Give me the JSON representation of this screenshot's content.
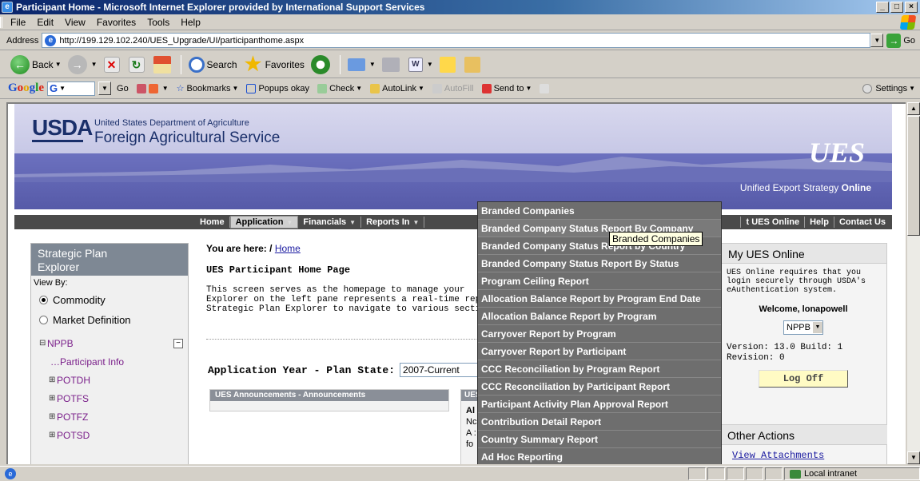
{
  "window": {
    "title": "Participant Home - Microsoft Internet Explorer provided by International Support Services",
    "menu": [
      "File",
      "Edit",
      "View",
      "Favorites",
      "Tools",
      "Help"
    ],
    "address_label": "Address",
    "address_url": "http://199.129.102.240/UES_Upgrade/UI/participanthome.aspx",
    "go_label": "Go"
  },
  "toolbar": {
    "back": "Back",
    "search": "Search",
    "favorites": "Favorites"
  },
  "googlebar": {
    "go": "Go",
    "bookmarks": "Bookmarks",
    "popups": "Popups okay",
    "check": "Check",
    "autolink": "AutoLink",
    "autofill": "AutoFill",
    "sendto": "Send to",
    "settings": "Settings"
  },
  "banner": {
    "logo": "USDA",
    "department": "United States Department of Agriculture",
    "agency": "Foreign Agricultural Service",
    "ues_logo": "UES",
    "tagline_main": "Unified Export Strategy",
    "tagline_accent": "Online"
  },
  "nav": {
    "left_items": [
      "Home",
      "Application",
      "Financials",
      "Reports In"
    ],
    "right_items": [
      "t UES Online",
      "Help",
      "Contact Us"
    ]
  },
  "explorer": {
    "title_line1": "Strategic Plan",
    "title_line2": "Explorer",
    "view_by": "View By:",
    "option_commodity": "Commodity",
    "option_market": "Market Definition",
    "tree_root": "NPPB",
    "tree_children": [
      "Participant Info",
      "POTDH",
      "POTFS",
      "POTFZ",
      "POTSD"
    ]
  },
  "main": {
    "breadcrumb_label": "You are here: /",
    "breadcrumb_link": "Home",
    "title": "UES Participant Home Page",
    "desc_line1": "This screen serves as the homepage to manage your",
    "desc_line2": "Explorer on the left pane represents a real-time repre",
    "desc_line3": "Strategic Plan Explorer to navigate to various section",
    "app_year_label": "Application Year - Plan State:",
    "app_year_value": "2007-Current",
    "announcements_header": "UES Announcements - Announcements",
    "announcements2_header": "UES",
    "alert_label": "Al",
    "alert_text_1": "Nc",
    "alert_text_2": "A :",
    "alert_text_3": "fo"
  },
  "right_panel": {
    "title": "My UES Online",
    "info": "UES Online requires that you login securely through USDA's eAuthentication system.",
    "welcome": "Welcome, lonapowell",
    "selected_org": "NPPB",
    "version": "Version: 13.0 Build: 1 Revision: 0",
    "logoff": "Log Off",
    "other_actions": "Other Actions",
    "view_attachments": "View Attachments"
  },
  "dropdown": {
    "items": [
      "Branded Companies",
      "Branded Company Status Report By Company",
      "Branded Company Status Report by Country",
      "Branded Company Status Report By Status",
      "Program Ceiling Report",
      "Allocation Balance Report by Program End Date",
      "Allocation Balance Report by Program",
      "Carryover Report by Program",
      "Carryover Report by Participant",
      "CCC Reconciliation by Program Report",
      "CCC Reconciliation by Participant Report",
      "Participant Activity Plan Approval Report",
      "Contribution Detail Report",
      "Country Summary Report",
      "Ad Hoc Reporting"
    ],
    "tooltip": "Branded Companies"
  },
  "statusbar": {
    "zone": "Local intranet"
  }
}
